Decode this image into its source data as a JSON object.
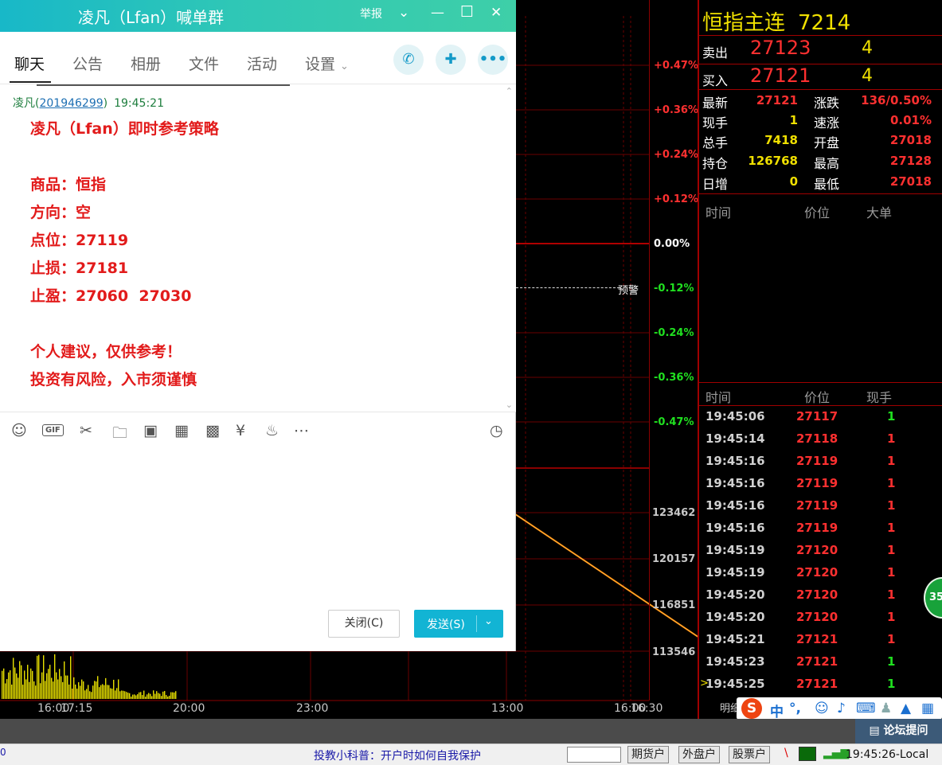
{
  "chat": {
    "title": "凌凡（Lfan）喊单群",
    "report": "举报",
    "tabs": [
      "聊天",
      "公告",
      "相册",
      "文件",
      "活动",
      "设置"
    ],
    "message": {
      "sender": "凌凡",
      "sender_id": "201946299",
      "time": "19:45:21",
      "lines": [
        "凌凡（Lfan）即时参考策略",
        "商品：恒指",
        "方向：空",
        "点位：27119",
        "止损：27181",
        "止盈：27060  27030",
        "个人建议，仅供参考！",
        "投资有风险，入市须谨慎"
      ]
    },
    "close_label": "关闭(C)",
    "send_label": "发送(S)"
  },
  "chart": {
    "pct_labels": [
      {
        "text": "+0.47%",
        "color": "#ff3030"
      },
      {
        "text": "+0.36%",
        "color": "#ff3030"
      },
      {
        "text": "+0.24%",
        "color": "#ff3030"
      },
      {
        "text": "+0.12%",
        "color": "#ff3030"
      },
      {
        "text": "0.00%",
        "color": "#ffffff"
      },
      {
        "text": "-0.12%",
        "color": "#20e020"
      },
      {
        "text": "-0.24%",
        "color": "#20e020"
      },
      {
        "text": "-0.36%",
        "color": "#20e020"
      },
      {
        "text": "-0.47%",
        "color": "#20e020"
      }
    ],
    "alert_label": "预警",
    "volume_labels": [
      "123462",
      "120157",
      "116851",
      "113546"
    ],
    "time_labels": [
      "16:00",
      "17:15",
      "20:00",
      "23:00",
      "13:00",
      "16:00",
      "16:30"
    ]
  },
  "quote": {
    "name": "恒指主连",
    "code": "7214",
    "ask_label": "卖出",
    "ask_price": "27123",
    "ask_vol": "4",
    "bid_label": "买入",
    "bid_price": "27121",
    "bid_vol": "4",
    "stats_left": [
      {
        "label": "最新",
        "value": "27121",
        "color": "#ff3030"
      },
      {
        "label": "现手",
        "value": "1",
        "color": "#f0e000"
      },
      {
        "label": "总手",
        "value": "7418",
        "color": "#f0e000"
      },
      {
        "label": "持仓",
        "value": "126768",
        "color": "#f0e000"
      },
      {
        "label": "日增",
        "value": "0",
        "color": "#f0e000"
      }
    ],
    "stats_right": [
      {
        "label": "涨跌",
        "value": "136/0.50%",
        "color": "#ff3030"
      },
      {
        "label": "速涨",
        "value": "0.01%",
        "color": "#ff3030"
      },
      {
        "label": "开盘",
        "value": "27018",
        "color": "#ff3030"
      },
      {
        "label": "最高",
        "value": "27128",
        "color": "#ff3030"
      },
      {
        "label": "最低",
        "value": "27018",
        "color": "#ff3030"
      }
    ],
    "big_order_headers": [
      "时间",
      "价位",
      "大单"
    ],
    "tick_headers": [
      "时间",
      "价位",
      "现手"
    ],
    "ticks": [
      {
        "time": "19:45:06",
        "price": "27117",
        "vol": "1",
        "color": "#20e020"
      },
      {
        "time": "19:45:14",
        "price": "27118",
        "vol": "1",
        "color": "#ff3030"
      },
      {
        "time": "19:45:16",
        "price": "27119",
        "vol": "1",
        "color": "#ff3030"
      },
      {
        "time": "19:45:16",
        "price": "27119",
        "vol": "1",
        "color": "#ff3030"
      },
      {
        "time": "19:45:16",
        "price": "27119",
        "vol": "1",
        "color": "#ff3030"
      },
      {
        "time": "19:45:16",
        "price": "27119",
        "vol": "1",
        "color": "#ff3030"
      },
      {
        "time": "19:45:19",
        "price": "27120",
        "vol": "1",
        "color": "#ff3030"
      },
      {
        "time": "19:45:19",
        "price": "27120",
        "vol": "1",
        "color": "#ff3030"
      },
      {
        "time": "19:45:20",
        "price": "27120",
        "vol": "1",
        "color": "#ff3030"
      },
      {
        "time": "19:45:20",
        "price": "27120",
        "vol": "1",
        "color": "#ff3030"
      },
      {
        "time": "19:45:21",
        "price": "27121",
        "vol": "1",
        "color": "#ff3030"
      },
      {
        "time": "19:45:23",
        "price": "27121",
        "vol": "1",
        "color": "#20e020"
      },
      {
        "time": "19:45:25",
        "price": "27121",
        "vol": "1",
        "color": "#20e020"
      }
    ],
    "detail_tab": "明细"
  },
  "status": {
    "edu_link": "投教小科普：开户时如何自我保护",
    "accounts": [
      "期货户",
      "外盘户",
      "股票户"
    ],
    "time": "19:45:26-Local",
    "forum": "论坛提问",
    "badge": "35"
  },
  "ime": {
    "lang": "中"
  }
}
